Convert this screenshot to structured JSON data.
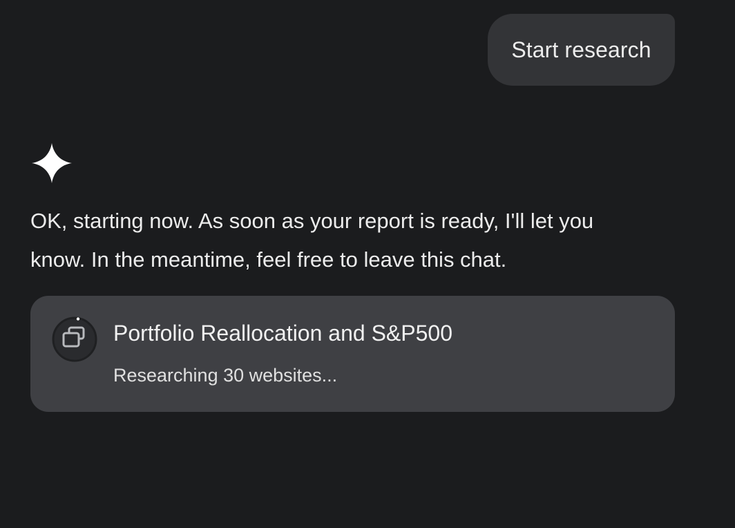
{
  "user_message": {
    "text": "Start research"
  },
  "assistant": {
    "icon": "gemini-sparkle-icon",
    "message_lines": [
      "OK, starting now. As soon as your report is ready, I'll let you",
      "know. In the meantime, feel free to leave this chat."
    ]
  },
  "research_card": {
    "title": "Portfolio Reallocation and S&P500",
    "status": "Researching 30 websites...",
    "icon": "research-stack-icon"
  },
  "colors": {
    "background": "#1b1c1e",
    "user_bubble": "#333437",
    "card": "#3f4044",
    "text": "#ececec"
  }
}
